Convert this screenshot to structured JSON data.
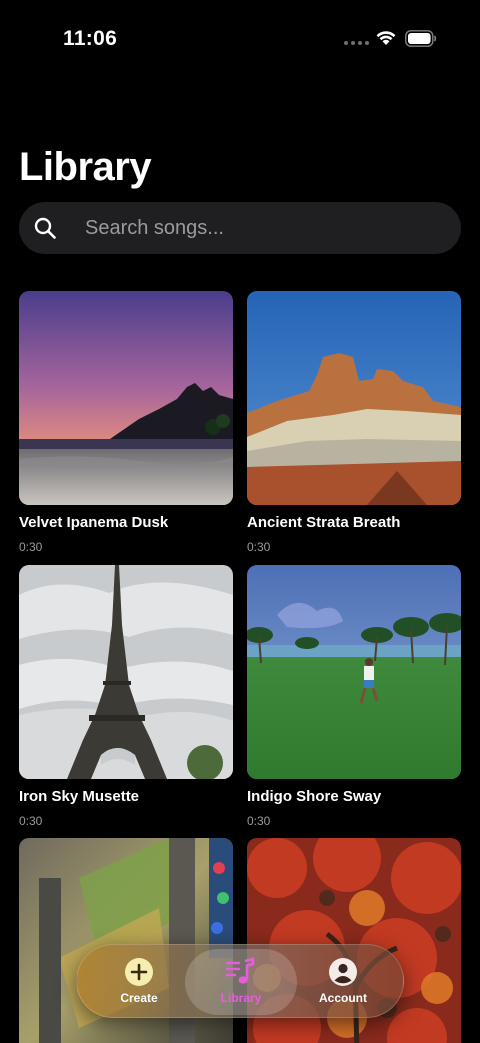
{
  "status_bar": {
    "time": "11:06"
  },
  "page": {
    "title": "Library"
  },
  "search": {
    "placeholder": "Search songs..."
  },
  "songs": [
    {
      "title": "Velvet Ipanema Dusk",
      "duration": "0:30"
    },
    {
      "title": "Ancient Strata Breath",
      "duration": "0:30"
    },
    {
      "title": "Iron Sky Musette",
      "duration": "0:30"
    },
    {
      "title": "Indigo Shore Sway",
      "duration": "0:30"
    },
    {
      "title": "",
      "duration": ""
    },
    {
      "title": "",
      "duration": ""
    }
  ],
  "tab_bar": {
    "tabs": [
      {
        "label": "Create",
        "icon": "plus-circle-icon"
      },
      {
        "label": "Library",
        "icon": "music-library-icon",
        "active": true
      },
      {
        "label": "Account",
        "icon": "person-icon"
      }
    ]
  },
  "colors": {
    "accent": "#e85de0",
    "background": "#000000",
    "search_bg": "#1f1f21"
  }
}
